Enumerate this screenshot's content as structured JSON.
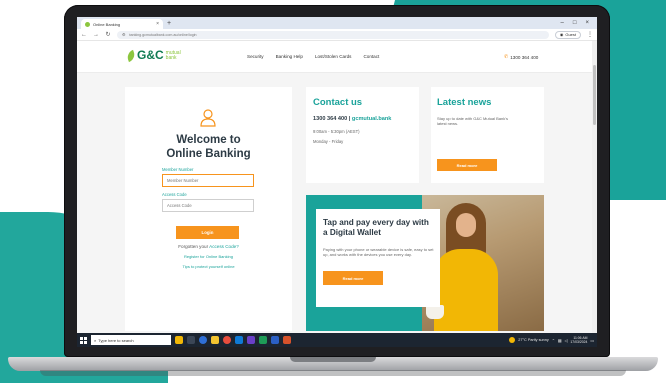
{
  "browser": {
    "tab_title": "Online Banking",
    "tab_close": "×",
    "new_tab": "+",
    "url": "banking.gcmutualbank.com.au/online/login",
    "profile_label": "Guest",
    "window_minimize": "–",
    "window_maximize": "□",
    "window_close": "×"
  },
  "header": {
    "logo_main": "G&C",
    "logo_sub_1": "mutual",
    "logo_sub_2": "bank",
    "nav": [
      "Security",
      "Banking Help",
      "Lost/Stolen Cards",
      "Contact"
    ],
    "phone": "1300 364 400"
  },
  "login": {
    "title_line1": "Welcome to",
    "title_line2": "Online Banking",
    "member_label": "Member Number",
    "member_placeholder": "Member Number",
    "access_label": "Access Code",
    "access_placeholder": "Access Code",
    "login_button": "Login",
    "forgot_text": "Forgotten your",
    "forgot_link": "Access Code?",
    "register_link": "Register for Online Banking",
    "tips_link": "Tips to protect yourself online"
  },
  "contact": {
    "title": "Contact us",
    "phone": "1300 364 400",
    "separator": "|",
    "email": "gcmutual.bank",
    "hours": "9:00am - 5:30pm (AEST)",
    "days": "Monday - Friday"
  },
  "news": {
    "title": "Latest news",
    "text": "Stay up to date with G&C Mutual Bank's latest news.",
    "button": "Read more"
  },
  "promo": {
    "title": "Tap and pay every day with a Digital Wallet",
    "text": "Paying with your phone or wearable device is safe, easy to set up, and works with the devices you use every day.",
    "button": "Read more"
  },
  "taskbar": {
    "search_placeholder": "Type here to search",
    "weather": "27°C  Partly sunny",
    "time": "11:06 AM",
    "date": "17/03/2024"
  },
  "colors": {
    "brand_teal": "#1aa39a",
    "brand_green": "#8cc63f",
    "accent_orange": "#f7941d",
    "heading_dark": "#2d3b45"
  }
}
